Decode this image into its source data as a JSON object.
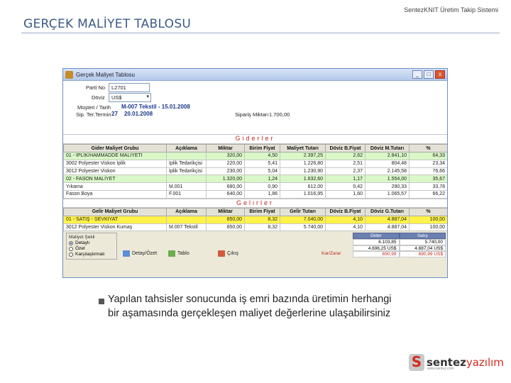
{
  "slide": {
    "title": "GERÇEK MALİYET TABLOSU",
    "brand_top": "SentezKNIT Üretim Takip Sistemi",
    "bullet_text": "Yapılan tahsisler sonucunda iş emri bazında üretimin herhangi bir aşamasında gerçekleşen maliyet değerlerine ulaşabilirsiniz",
    "logo_text": "sentez",
    "logo_text_accent": "yazılım",
    "logo_sub": "www.sentez.com"
  },
  "window": {
    "title": "Gerçek Maliyet Tablosu",
    "btn_min": "_",
    "btn_max": "□",
    "btn_close": "x"
  },
  "form": {
    "parti_label": "Parti No",
    "parti_value": "L2701",
    "doviz_label": "Döviz",
    "doviz_value": "US$",
    "musteri_label": "Müşteri / Tarih",
    "musteri_value": "M-007 Tekstil  -  15.01.2008",
    "sip_termin_label": "Sip. Ter.Termin",
    "sip_termin_num": "27",
    "sip_termin_date": "20.01.2008",
    "siparis_label": "Sipariş Miktarı",
    "siparis_value": "1.700,00"
  },
  "giderler": {
    "header": "Giderler",
    "columns": [
      "Gider Maliyet Grubu",
      "Açıklama",
      "Miktar",
      "Birim Fiyat",
      "Maliyet Tutarı",
      "Döviz B.Fiyat",
      "Döviz M.Tutarı",
      "%"
    ],
    "rows": [
      [
        "01 - İPLİK/HAMMADDE MALİYETİ",
        "",
        "320,00",
        "4,50",
        "2.397,25",
        "2,62",
        "2.841,10",
        "64,33"
      ],
      [
        "3002 Polyester Viskon İplik",
        "İplik Tedarikçisi",
        "220,00",
        "5,41",
        "1.226,80",
        "2,51",
        "804,48",
        "23,34"
      ],
      [
        "3012 Polyester Viskon",
        "İplik Tedarikçisi",
        "230,00",
        "5,04",
        "1.230,90",
        "2,37",
        "2.145,58",
        "76,66"
      ],
      [
        "02 - FASON MALİYET",
        "",
        "1.320,00",
        "1,24",
        "1.632,60",
        "1,17",
        "1.554,00",
        "35,67"
      ],
      [
        "Yıkama",
        "M.001",
        "680,00",
        "0,90",
        "612,00",
        "0,42",
        "290,33",
        "33,78"
      ],
      [
        "Fason Boya",
        "F.001",
        "640,00",
        "1,86",
        "1.016,95",
        "1,60",
        "1.065,57",
        "66,22"
      ]
    ]
  },
  "gelirler": {
    "header": "Gelirler",
    "columns": [
      "Gelir Maliyet Grubu",
      "Açıklama",
      "Miktar",
      "Birim Fiyat",
      "Gelir Tutarı",
      "Döviz B.Fiyat",
      "Döviz G.Tutarı",
      "%"
    ],
    "rows": [
      [
        "01 - SATIŞ - SEVKİYAT",
        "",
        "850,00",
        "8,32",
        "7.040,00",
        "4,10",
        "4.887,04",
        "100,00"
      ],
      [
        "3012 Polyester Viskon Kumaş",
        "M.007 Tekstil",
        "850,00",
        "8,32",
        "5.740,00",
        "4,10",
        "4.887,04",
        "100,00"
      ]
    ]
  },
  "bottom": {
    "radio_legend": "Maliyet Şekli",
    "radio_options": [
      "Detaylı",
      "Özet",
      "Karşılaştırmalı"
    ],
    "btn_detay": "Detay/Özet",
    "btn_tablo": "Tablo",
    "btn_cikis": "Çıkış",
    "summary_head": [
      "Gider",
      "Satış"
    ],
    "summary_rows": [
      [
        "",
        "6.103,85",
        "5.740,00"
      ],
      [
        "",
        "4.696,25 US$",
        "4.887,04 US$"
      ],
      [
        "Kar/Zarar",
        "690,99",
        "690,99 US$"
      ]
    ]
  },
  "colors": {
    "title_blue": "#3b5a88",
    "section_red": "#c0281e",
    "row_green": "#d9f7c7",
    "row_yellow": "#fff24a"
  }
}
